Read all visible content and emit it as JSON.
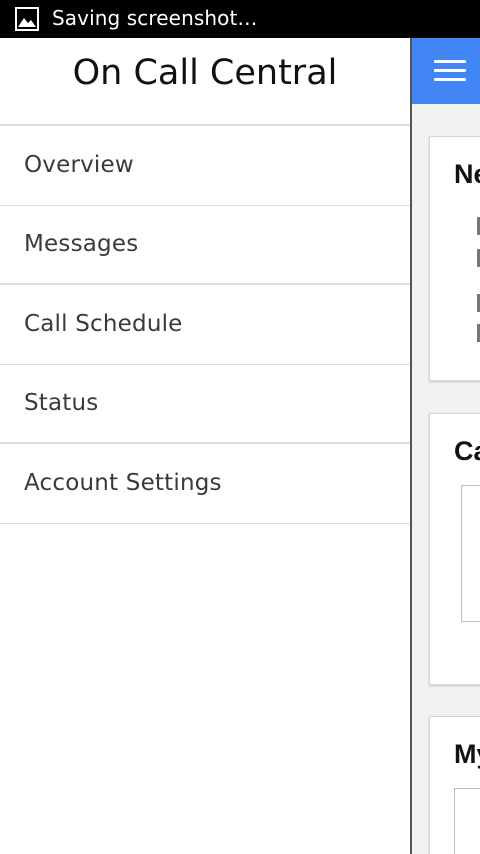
{
  "status_bar": {
    "text": "Saving screenshot…",
    "icon": "image-icon"
  },
  "app_bar": {
    "color": "#4285f4",
    "menu_icon": "hamburger-menu-icon"
  },
  "drawer": {
    "title": "On Call Central",
    "items": [
      {
        "label": "Overview"
      },
      {
        "label": "Messages"
      },
      {
        "label": "Call Schedule"
      },
      {
        "label": "Status"
      },
      {
        "label": "Account Settings"
      }
    ]
  },
  "main": {
    "cards": [
      {
        "title": "Ne",
        "fragments": [
          "",
          "",
          "",
          ""
        ]
      },
      {
        "title": "Ca"
      },
      {
        "title": "My"
      }
    ]
  }
}
